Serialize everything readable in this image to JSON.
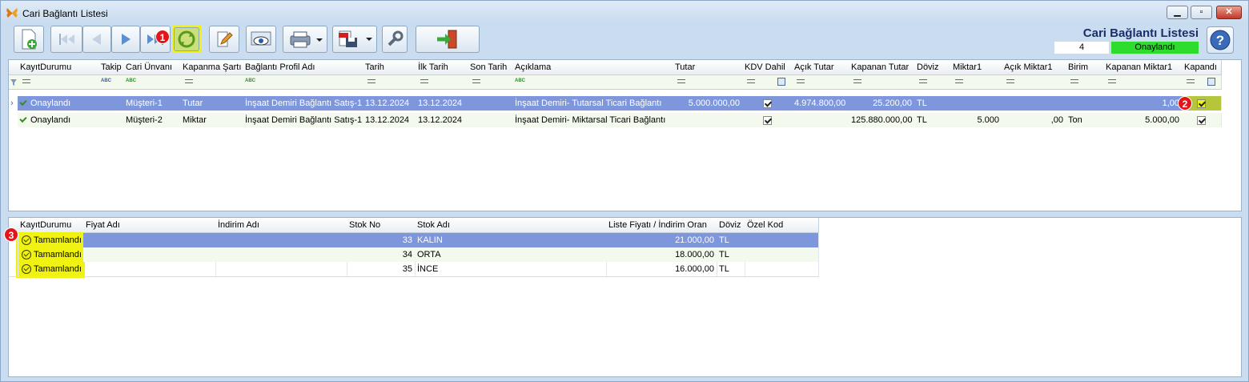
{
  "window": {
    "title": "Cari Bağlantı Listesi"
  },
  "header": {
    "title": "Cari Bağlantı Listesi",
    "count": "4",
    "status": "Onaylandı"
  },
  "badges": {
    "b1": "1",
    "b2": "2",
    "b3": "3"
  },
  "grid1": {
    "columns": [
      "KayıtDurumu",
      "Takip",
      "Cari Ünvanı",
      "Kapanma Şartı",
      "Bağlantı Profil Adı",
      "Tarih",
      "İlk Tarih",
      "Son Tarih",
      "Açıklama",
      "Tutar",
      "KDV Dahil",
      "Açık Tutar",
      "Kapanan Tutar",
      "Döviz",
      "Miktar1",
      "Açık Miktar1",
      "Birim",
      "Kapanan Miktar1",
      "Kapandı"
    ],
    "rows": [
      {
        "status": "Onaylandı",
        "takip": "",
        "cari": "Müşteri-1",
        "sart": "Tutar",
        "profil": "İnşaat Demiri Bağlantı Satış-1",
        "tarih": "13.12.2024",
        "ilk": "13.12.2024",
        "son": "",
        "aciklama": "İnşaat Demiri- Tutarsal Ticari Bağlantı",
        "tutar": "5.000.000,00",
        "acik_tutar": "4.974.800,00",
        "kapanan_tutar": "25.200,00",
        "doviz": "TL",
        "miktar": "",
        "acik_miktar": "",
        "birim": "",
        "kapanan_miktar": "1,00"
      },
      {
        "status": "Onaylandı",
        "takip": "",
        "cari": "Müşteri-2",
        "sart": "Miktar",
        "profil": "İnşaat Demiri Bağlantı Satış-1",
        "tarih": "13.12.2024",
        "ilk": "13.12.2024",
        "son": "",
        "aciklama": "İnşaat Demiri- Miktarsal Ticari Bağlantı",
        "tutar": "",
        "acik_tutar": "",
        "kapanan_tutar": "125.880.000,00",
        "doviz": "TL",
        "miktar": "5.000",
        "acik_miktar": ",00",
        "birim": "Ton",
        "kapanan_miktar": "5.000,00"
      }
    ]
  },
  "grid2": {
    "columns": [
      "KayıtDurumu",
      "Fiyat Adı",
      "İndirim Adı",
      "Stok No",
      "Stok Adı",
      "Liste Fiyatı / İndirim Oran",
      "Döviz",
      "Özel Kod"
    ],
    "rows": [
      {
        "status": "Tamamlandı",
        "fiyat": "",
        "indirim": "",
        "stok_no": "33",
        "stok_adi": "KALIN",
        "liste": "21.000,00",
        "doviz": "TL",
        "ozel": ""
      },
      {
        "status": "Tamamlandı",
        "fiyat": "",
        "indirim": "",
        "stok_no": "34",
        "stok_adi": "ORTA",
        "liste": "18.000,00",
        "doviz": "TL",
        "ozel": ""
      },
      {
        "status": "Tamamlandı",
        "fiyat": "",
        "indirim": "",
        "stok_no": "35",
        "stok_adi": "İNCE",
        "liste": "16.000,00",
        "doviz": "TL",
        "ozel": ""
      }
    ]
  }
}
